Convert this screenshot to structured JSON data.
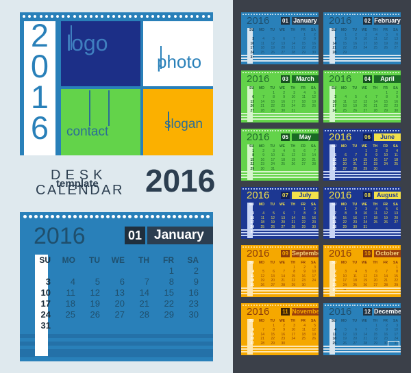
{
  "page": {
    "background": "#dfe9ee",
    "right_panel_bg": "#3b4049"
  },
  "cover": {
    "year_digits": [
      "2",
      "0",
      "1",
      "6"
    ],
    "panels": [
      {
        "name": "logo",
        "label": "logo",
        "color": "#1c2f87",
        "text_color": "#3f7fbf"
      },
      {
        "name": "photo",
        "label": "photo",
        "color": "#ffffff",
        "text_color": "#2980b9"
      },
      {
        "name": "contact",
        "label": "contact",
        "color": "#63d34a",
        "text_color": "#2b6e96"
      },
      {
        "name": "slogan",
        "label": "slogan",
        "color": "#fbb000",
        "text_color": "#2b6e96"
      }
    ],
    "accent": "#2980b9"
  },
  "title": {
    "desk": "DESK",
    "template": "template",
    "calendar": "CALENDAR",
    "year": "2016",
    "color": "#2c3e50"
  },
  "big_calendar": {
    "year": "2016",
    "month_number": "01",
    "month_name": "January",
    "weekday_headers": [
      "SU",
      "MO",
      "TU",
      "WE",
      "TH",
      "FR",
      "SA"
    ],
    "weeks": [
      [
        "",
        "",
        "",
        "",
        "",
        "1",
        "2"
      ],
      [
        "3",
        "4",
        "5",
        "6",
        "7",
        "8",
        "9"
      ],
      [
        "10",
        "11",
        "12",
        "13",
        "14",
        "15",
        "16"
      ],
      [
        "17",
        "18",
        "19",
        "20",
        "21",
        "22",
        "23"
      ],
      [
        "24",
        "25",
        "26",
        "27",
        "28",
        "29",
        "30"
      ],
      [
        "31",
        "",
        "",
        "",
        "",
        "",
        ""
      ]
    ],
    "bg": "#2980b9",
    "text": "#1f4f6d",
    "sunday_color": "#1f2f3d",
    "badge_bg": "#1f2f3d",
    "name_bg": "#2c3e50",
    "badge_text": "#ffffff"
  },
  "months": [
    {
      "year": "2016",
      "number": "01",
      "name": "January",
      "bg": "#2980b9",
      "header_text": "#1f4f6d",
      "day_text": "#1f4f6d",
      "sunday_color": "#0d2b40",
      "num_bg": "#1f2f3d",
      "num_text": "#ffffff",
      "name_bg": "#2c3e50",
      "name_text": "#ffffff",
      "line_color": "#d9e6ef",
      "dot_color": "#bcd7e8",
      "weekday_headers": [
        "SU",
        "MO",
        "TU",
        "WE",
        "TH",
        "FR",
        "SA"
      ],
      "weeks": [
        [
          "",
          "",
          "",
          "",
          "",
          "1",
          "2"
        ],
        [
          "3",
          "4",
          "5",
          "6",
          "7",
          "8",
          "9"
        ],
        [
          "10",
          "11",
          "12",
          "13",
          "14",
          "15",
          "16"
        ],
        [
          "17",
          "18",
          "19",
          "20",
          "21",
          "22",
          "23"
        ],
        [
          "24",
          "25",
          "26",
          "27",
          "28",
          "29",
          "30"
        ],
        [
          "31",
          "",
          "",
          "",
          "",
          "",
          ""
        ]
      ]
    },
    {
      "year": "2016",
      "number": "02",
      "name": "February",
      "bg": "#2980b9",
      "header_text": "#1f4f6d",
      "day_text": "#1f4f6d",
      "sunday_color": "#0d2b40",
      "num_bg": "#1f2f3d",
      "num_text": "#ffffff",
      "name_bg": "#2c3e50",
      "name_text": "#ffffff",
      "line_color": "#d9e6ef",
      "dot_color": "#bcd7e8",
      "weekday_headers": [
        "SU",
        "MO",
        "TU",
        "WE",
        "TH",
        "FR",
        "SA"
      ],
      "weeks": [
        [
          "",
          "1",
          "2",
          "3",
          "4",
          "5",
          "6"
        ],
        [
          "7",
          "8",
          "9",
          "10",
          "11",
          "12",
          "13"
        ],
        [
          "14",
          "15",
          "16",
          "17",
          "18",
          "19",
          "20"
        ],
        [
          "21",
          "22",
          "23",
          "24",
          "25",
          "26",
          "27"
        ],
        [
          "28",
          "29",
          "",
          "",
          "",
          "",
          ""
        ]
      ]
    },
    {
      "year": "2016",
      "number": "03",
      "name": "March",
      "bg": "#63d34a",
      "header_text": "#1f6b2a",
      "day_text": "#1f6b2a",
      "sunday_color": "#14501d",
      "num_bg": "#14501d",
      "num_text": "#ffffff",
      "name_bg": "#1a6b24",
      "name_text": "#ffffff",
      "line_color": "#d6f5cc",
      "dot_color": "#c8f0bd",
      "weekday_headers": [
        "SU",
        "MO",
        "TU",
        "WE",
        "TH",
        "FR",
        "SA"
      ],
      "weeks": [
        [
          "",
          "",
          "1",
          "2",
          "3",
          "4",
          "5"
        ],
        [
          "6",
          "7",
          "8",
          "9",
          "10",
          "11",
          "12"
        ],
        [
          "13",
          "14",
          "15",
          "16",
          "17",
          "18",
          "19"
        ],
        [
          "20",
          "21",
          "22",
          "23",
          "24",
          "25",
          "26"
        ],
        [
          "27",
          "28",
          "29",
          "30",
          "31",
          "",
          ""
        ]
      ]
    },
    {
      "year": "2016",
      "number": "04",
      "name": "April",
      "bg": "#63d34a",
      "header_text": "#1f6b2a",
      "day_text": "#1f6b2a",
      "sunday_color": "#14501d",
      "num_bg": "#14501d",
      "num_text": "#ffffff",
      "name_bg": "#1a6b24",
      "name_text": "#ffffff",
      "line_color": "#d6f5cc",
      "dot_color": "#c8f0bd",
      "weekday_headers": [
        "SU",
        "MO",
        "TU",
        "WE",
        "TH",
        "FR",
        "SA"
      ],
      "weeks": [
        [
          "",
          "",
          "",
          "",
          "",
          "1",
          "2"
        ],
        [
          "3",
          "4",
          "5",
          "6",
          "7",
          "8",
          "9"
        ],
        [
          "10",
          "11",
          "12",
          "13",
          "14",
          "15",
          "16"
        ],
        [
          "17",
          "18",
          "19",
          "20",
          "21",
          "22",
          "23"
        ],
        [
          "24",
          "25",
          "26",
          "27",
          "28",
          "29",
          "30"
        ]
      ]
    },
    {
      "year": "2016",
      "number": "05",
      "name": "May",
      "bg": "#63d34a",
      "header_text": "#1f6b2a",
      "day_text": "#1f6b2a",
      "sunday_color": "#14501d",
      "num_bg": "#14501d",
      "num_text": "#ffffff",
      "name_bg": "#1a6b24",
      "name_text": "#ffffff",
      "line_color": "#d6f5cc",
      "dot_color": "#c8f0bd",
      "weekday_headers": [
        "SU",
        "MO",
        "TU",
        "WE",
        "TH",
        "FR",
        "SA"
      ],
      "weeks": [
        [
          "1",
          "2",
          "3",
          "4",
          "5",
          "6",
          "7"
        ],
        [
          "8",
          "9",
          "10",
          "11",
          "12",
          "13",
          "14"
        ],
        [
          "15",
          "16",
          "17",
          "18",
          "19",
          "20",
          "21"
        ],
        [
          "22",
          "23",
          "24",
          "25",
          "26",
          "27",
          "28"
        ],
        [
          "29",
          "30",
          "31",
          "",
          "",
          "",
          ""
        ]
      ]
    },
    {
      "year": "2016",
      "number": "06",
      "name": "June",
      "bg": "#1c3792",
      "header_text": "#f2e04a",
      "day_text": "#f2e04a",
      "sunday_color": "#ffffff",
      "num_bg": "#101f5c",
      "num_text": "#f2e04a",
      "name_bg": "#f2e04a",
      "name_text": "#1c3792",
      "line_color": "#c9d6f5",
      "dot_color": "#b5c6ef",
      "weekday_headers": [
        "SU",
        "MO",
        "TU",
        "WE",
        "TH",
        "FR",
        "SA"
      ],
      "weeks": [
        [
          "",
          "",
          "",
          "1",
          "2",
          "3",
          "4"
        ],
        [
          "5",
          "6",
          "7",
          "8",
          "9",
          "10",
          "11"
        ],
        [
          "12",
          "13",
          "14",
          "15",
          "16",
          "17",
          "18"
        ],
        [
          "19",
          "20",
          "21",
          "22",
          "23",
          "24",
          "25"
        ],
        [
          "26",
          "27",
          "28",
          "29",
          "30",
          "",
          ""
        ]
      ]
    },
    {
      "year": "2016",
      "number": "07",
      "name": "July",
      "bg": "#1c3792",
      "header_text": "#f2e04a",
      "day_text": "#f2e04a",
      "sunday_color": "#ffffff",
      "num_bg": "#101f5c",
      "num_text": "#f2e04a",
      "name_bg": "#f2e04a",
      "name_text": "#1c3792",
      "line_color": "#c9d6f5",
      "dot_color": "#b5c6ef",
      "weekday_headers": [
        "SU",
        "MO",
        "TU",
        "WE",
        "TH",
        "FR",
        "SA"
      ],
      "weeks": [
        [
          "",
          "",
          "",
          "",
          "",
          "1",
          "2"
        ],
        [
          "3",
          "4",
          "5",
          "6",
          "7",
          "8",
          "9"
        ],
        [
          "10",
          "11",
          "12",
          "13",
          "14",
          "15",
          "16"
        ],
        [
          "17",
          "18",
          "19",
          "20",
          "21",
          "22",
          "23"
        ],
        [
          "24",
          "25",
          "26",
          "27",
          "28",
          "29",
          "30"
        ],
        [
          "31",
          "",
          "",
          "",
          "",
          "",
          ""
        ]
      ]
    },
    {
      "year": "2016",
      "number": "08",
      "name": "August",
      "bg": "#1c3792",
      "header_text": "#f2e04a",
      "day_text": "#f2e04a",
      "sunday_color": "#ffffff",
      "num_bg": "#101f5c",
      "num_text": "#f2e04a",
      "name_bg": "#f2e04a",
      "name_text": "#1c3792",
      "line_color": "#c9d6f5",
      "dot_color": "#b5c6ef",
      "weekday_headers": [
        "SU",
        "MO",
        "TU",
        "WE",
        "TH",
        "FR",
        "SA"
      ],
      "weeks": [
        [
          "",
          "1",
          "2",
          "3",
          "4",
          "5",
          "6"
        ],
        [
          "7",
          "8",
          "9",
          "10",
          "11",
          "12",
          "13"
        ],
        [
          "14",
          "15",
          "16",
          "17",
          "18",
          "19",
          "20"
        ],
        [
          "21",
          "22",
          "23",
          "24",
          "25",
          "26",
          "27"
        ],
        [
          "28",
          "29",
          "30",
          "31",
          "",
          "",
          ""
        ]
      ]
    },
    {
      "year": "2016",
      "number": "09",
      "name": "September",
      "bg": "#f5a800",
      "header_text": "#8a3a0a",
      "day_text": "#8a3a0a",
      "sunday_color": "#ffffff",
      "num_bg": "#8a3a0a",
      "num_text": "#f5a800",
      "name_bg": "#9c3f0c",
      "name_text": "#f5d27a",
      "line_color": "#ffe7b0",
      "dot_color": "#ffd98a",
      "weekday_headers": [
        "SU",
        "MO",
        "TU",
        "WE",
        "TH",
        "FR",
        "SA"
      ],
      "weeks": [
        [
          "",
          "",
          "",
          "",
          "1",
          "2",
          "3"
        ],
        [
          "4",
          "5",
          "6",
          "7",
          "8",
          "9",
          "10"
        ],
        [
          "11",
          "12",
          "13",
          "14",
          "15",
          "16",
          "17"
        ],
        [
          "18",
          "19",
          "20",
          "21",
          "22",
          "23",
          "24"
        ],
        [
          "25",
          "26",
          "27",
          "28",
          "29",
          "30",
          ""
        ]
      ]
    },
    {
      "year": "2016",
      "number": "10",
      "name": "October",
      "bg": "#f5a800",
      "header_text": "#8a3a0a",
      "day_text": "#8a3a0a",
      "sunday_color": "#ffffff",
      "num_bg": "#8a3a0a",
      "num_text": "#f5a800",
      "name_bg": "#9c3f0c",
      "name_text": "#f5d27a",
      "line_color": "#ffe7b0",
      "dot_color": "#ffd98a",
      "weekday_headers": [
        "SU",
        "MO",
        "TU",
        "WE",
        "TH",
        "FR",
        "SA"
      ],
      "weeks": [
        [
          "",
          "",
          "",
          "",
          "",
          "",
          "1"
        ],
        [
          "2",
          "3",
          "4",
          "5",
          "6",
          "7",
          "8"
        ],
        [
          "9",
          "10",
          "11",
          "12",
          "13",
          "14",
          "15"
        ],
        [
          "16",
          "17",
          "18",
          "19",
          "20",
          "21",
          "22"
        ],
        [
          "23",
          "24",
          "25",
          "26",
          "27",
          "28",
          "29"
        ],
        [
          "30",
          "31",
          "",
          "",
          "",
          "",
          ""
        ]
      ]
    },
    {
      "year": "2016",
      "number": "11",
      "name": "November",
      "bg": "#f5a800",
      "header_text": "#8a3a0a",
      "day_text": "#8a3a0a",
      "sunday_color": "#ffffff",
      "num_bg": "#3d2206",
      "num_text": "#f5a800",
      "name_bg": "#9c3f0c",
      "name_text": "#f5a800",
      "line_color": "#ffe7b0",
      "dot_color": "#ffd98a",
      "weekday_headers": [
        "SU",
        "MO",
        "TU",
        "WE",
        "TH",
        "FR",
        "SA"
      ],
      "weeks": [
        [
          "",
          "",
          "1",
          "2",
          "3",
          "4",
          "5"
        ],
        [
          "6",
          "7",
          "8",
          "9",
          "10",
          "11",
          "12"
        ],
        [
          "13",
          "14",
          "15",
          "16",
          "17",
          "18",
          "19"
        ],
        [
          "20",
          "21",
          "22",
          "23",
          "24",
          "25",
          "26"
        ],
        [
          "27",
          "28",
          "29",
          "30",
          "",
          "",
          ""
        ]
      ]
    },
    {
      "year": "2016",
      "number": "12",
      "name": "December",
      "bg": "#2980b9",
      "header_text": "#1f4f6d",
      "day_text": "#1f4f6d",
      "sunday_color": "#0d2b40",
      "num_bg": "#1f2f3d",
      "num_text": "#ffffff",
      "name_bg": "#2c3e50",
      "name_text": "#ffffff",
      "line_color": "#d9e6ef",
      "dot_color": "#bcd7e8",
      "weekday_headers": [
        "SU",
        "MO",
        "TU",
        "WE",
        "TH",
        "FR",
        "SA"
      ],
      "weeks": [
        [
          "",
          "",
          "",
          "",
          "1",
          "2",
          "3"
        ],
        [
          "4",
          "5",
          "6",
          "7",
          "8",
          "9",
          "10"
        ],
        [
          "11",
          "12",
          "13",
          "14",
          "15",
          "16",
          "17"
        ],
        [
          "18",
          "19",
          "20",
          "21",
          "22",
          "23",
          "24"
        ],
        [
          "25",
          "26",
          "27",
          "28",
          "29",
          "30",
          "31"
        ]
      ],
      "highlight": {
        "week": 4,
        "cell": 6
      }
    }
  ]
}
